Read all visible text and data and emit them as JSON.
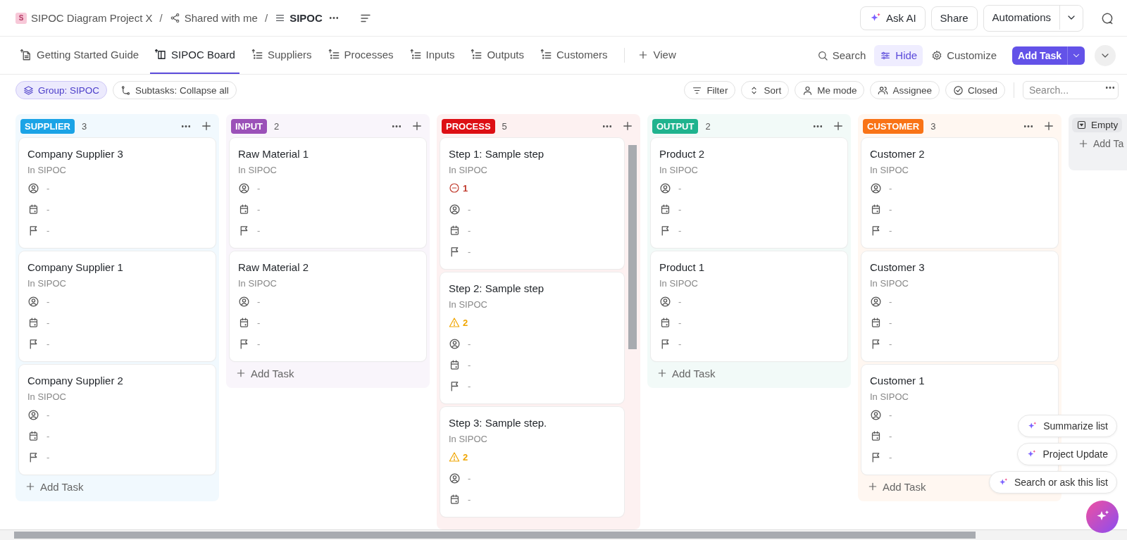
{
  "breadcrumb": {
    "space_initial": "S",
    "items": [
      {
        "kind": "space",
        "text": "SIPOC Diagram Project X"
      },
      {
        "kind": "shared",
        "text": "Shared with me"
      },
      {
        "kind": "list",
        "text": "SIPOC"
      }
    ],
    "separators": [
      "/",
      "/"
    ]
  },
  "header_actions": [
    {
      "kind": "ai",
      "label": "Ask AI"
    },
    {
      "kind": "plain",
      "label": "Share"
    },
    {
      "kind": "split",
      "label": "Automations"
    }
  ],
  "tabs": [
    {
      "kind": "doc",
      "label": "Getting Started Guide",
      "selected": false
    },
    {
      "kind": "board",
      "label": "SIPOC Board",
      "selected": true
    },
    {
      "kind": "list",
      "label": "Suppliers",
      "selected": false
    },
    {
      "kind": "list",
      "label": "Processes",
      "selected": false
    },
    {
      "kind": "list",
      "label": "Inputs",
      "selected": false
    },
    {
      "kind": "list",
      "label": "Outputs",
      "selected": false
    },
    {
      "kind": "list",
      "label": "Customers",
      "selected": false
    }
  ],
  "add_view": "View",
  "view_actions": [
    {
      "kind": "search",
      "label": "Search",
      "selected": false
    },
    {
      "kind": "hide",
      "label": "Hide",
      "selected": true
    },
    {
      "kind": "customize",
      "label": "Customize",
      "selected": false
    }
  ],
  "add_task_button": "Add Task",
  "chips": [
    {
      "kind": "group",
      "label": "Group: SIPOC",
      "selected": true
    },
    {
      "kind": "subtasks",
      "label": "Subtasks: Collapse all",
      "selected": false
    }
  ],
  "filters": [
    {
      "kind": "filter",
      "label": "Filter"
    },
    {
      "kind": "sort",
      "label": "Sort"
    },
    {
      "kind": "me",
      "label": "Me mode"
    },
    {
      "kind": "assignee",
      "label": "Assignee"
    },
    {
      "kind": "closed",
      "label": "Closed"
    }
  ],
  "search": {
    "placeholder": "Search..."
  },
  "columns": [
    {
      "label": "SUPPLIER",
      "color": "#1ba3e6",
      "count": "3",
      "add_task": "Add Task",
      "cards": [
        {
          "title": "Company Supplier 3",
          "location": "In SIPOC",
          "fields": [
            {
              "kind": "assignee",
              "value": "-"
            },
            {
              "kind": "date",
              "value": "-"
            },
            {
              "kind": "priority",
              "value": "-"
            }
          ]
        },
        {
          "title": "Company Supplier 1",
          "location": "In SIPOC",
          "fields": [
            {
              "kind": "assignee",
              "value": "-"
            },
            {
              "kind": "date",
              "value": "-"
            },
            {
              "kind": "priority",
              "value": "-"
            }
          ]
        },
        {
          "title": "Company Supplier 2",
          "location": "In SIPOC",
          "fields": [
            {
              "kind": "assignee",
              "value": "-"
            },
            {
              "kind": "date",
              "value": "-"
            },
            {
              "kind": "priority",
              "value": "-"
            }
          ]
        }
      ]
    },
    {
      "label": "INPUT",
      "color": "#9b51b8",
      "count": "2",
      "add_task": "Add Task",
      "cards": [
        {
          "title": "Raw Material 1",
          "location": "In SIPOC",
          "fields": [
            {
              "kind": "assignee",
              "value": "-"
            },
            {
              "kind": "date",
              "value": "-"
            },
            {
              "kind": "priority",
              "value": "-"
            }
          ]
        },
        {
          "title": "Raw Material 2",
          "location": "In SIPOC",
          "fields": [
            {
              "kind": "assignee",
              "value": "-"
            },
            {
              "kind": "date",
              "value": "-"
            },
            {
              "kind": "priority",
              "value": "-"
            }
          ]
        }
      ]
    },
    {
      "label": "PROCESS",
      "color": "#dd0f14",
      "count": "5",
      "scrollable": true,
      "cards": [
        {
          "title": "Step 1: Sample step",
          "location": "In SIPOC",
          "badge": {
            "kind": "blocked",
            "text": "1"
          },
          "fields": [
            {
              "kind": "assignee",
              "value": "-"
            },
            {
              "kind": "date",
              "value": "-"
            },
            {
              "kind": "priority",
              "value": "-"
            }
          ]
        },
        {
          "title": "Step 2: Sample step",
          "location": "In SIPOC",
          "badge": {
            "kind": "warning",
            "text": "2"
          },
          "fields": [
            {
              "kind": "assignee",
              "value": "-"
            },
            {
              "kind": "date",
              "value": "-"
            },
            {
              "kind": "priority",
              "value": "-"
            }
          ]
        },
        {
          "title": "Step 3: Sample step.",
          "location": "In SIPOC",
          "badge": {
            "kind": "warning",
            "text": "2"
          },
          "fields": [
            {
              "kind": "assignee",
              "value": "-"
            },
            {
              "kind": "date",
              "value": "-"
            }
          ]
        }
      ]
    },
    {
      "label": "OUTPUT",
      "color": "#1fb38e",
      "count": "2",
      "add_task": "Add Task",
      "cards": [
        {
          "title": "Product 2",
          "location": "In SIPOC",
          "fields": [
            {
              "kind": "assignee",
              "value": "-"
            },
            {
              "kind": "date",
              "value": "-"
            },
            {
              "kind": "priority",
              "value": "-"
            }
          ]
        },
        {
          "title": "Product 1",
          "location": "In SIPOC",
          "fields": [
            {
              "kind": "assignee",
              "value": "-"
            },
            {
              "kind": "date",
              "value": "-"
            },
            {
              "kind": "priority",
              "value": "-"
            }
          ]
        }
      ]
    },
    {
      "label": "CUSTOMER",
      "color": "#f97316",
      "count": "3",
      "add_task": "Add Task",
      "cards": [
        {
          "title": "Customer 2",
          "location": "In SIPOC",
          "fields": [
            {
              "kind": "assignee",
              "value": "-"
            },
            {
              "kind": "date",
              "value": "-"
            },
            {
              "kind": "priority",
              "value": "-"
            }
          ]
        },
        {
          "title": "Customer 3",
          "location": "In SIPOC",
          "fields": [
            {
              "kind": "assignee",
              "value": "-"
            },
            {
              "kind": "date",
              "value": "-"
            },
            {
              "kind": "priority",
              "value": "-"
            }
          ]
        },
        {
          "title": "Customer 1",
          "location": "In SIPOC",
          "fields": [
            {
              "kind": "assignee",
              "value": "-"
            },
            {
              "kind": "date",
              "value": "-"
            },
            {
              "kind": "priority",
              "value": "-"
            }
          ]
        }
      ]
    }
  ],
  "empty_group": {
    "label": "Empty",
    "add_task": "Add Ta"
  },
  "ai_actions": [
    "Summarize list",
    "Project Update",
    "Search or ask this list"
  ]
}
